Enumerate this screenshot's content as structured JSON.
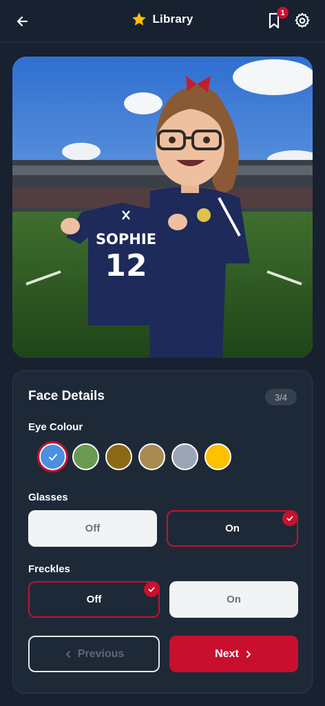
{
  "header": {
    "title": "Library",
    "badge_count": "1",
    "icons": [
      "back-arrow-icon",
      "star-icon",
      "bookmark-icon",
      "gear-icon"
    ]
  },
  "hero": {
    "shirt_name": "SOPHIE",
    "shirt_number": "12"
  },
  "card": {
    "title": "Face Details",
    "step": "3/4",
    "eye_colour": {
      "label": "Eye Colour",
      "options": [
        "#4a8fe0",
        "#6a9a52",
        "#8b6914",
        "#a88a52",
        "#9aa6b8",
        "#ffc000"
      ],
      "selected_index": 0
    },
    "glasses": {
      "label": "Glasses",
      "off_label": "Off",
      "on_label": "On",
      "selected": "On"
    },
    "freckles": {
      "label": "Freckles",
      "off_label": "Off",
      "on_label": "On",
      "selected": "Off"
    },
    "nav": {
      "previous_label": "Previous",
      "next_label": "Next"
    }
  },
  "colors": {
    "background": "#172130",
    "accent": "#c8102e",
    "card": "#1e2938"
  }
}
